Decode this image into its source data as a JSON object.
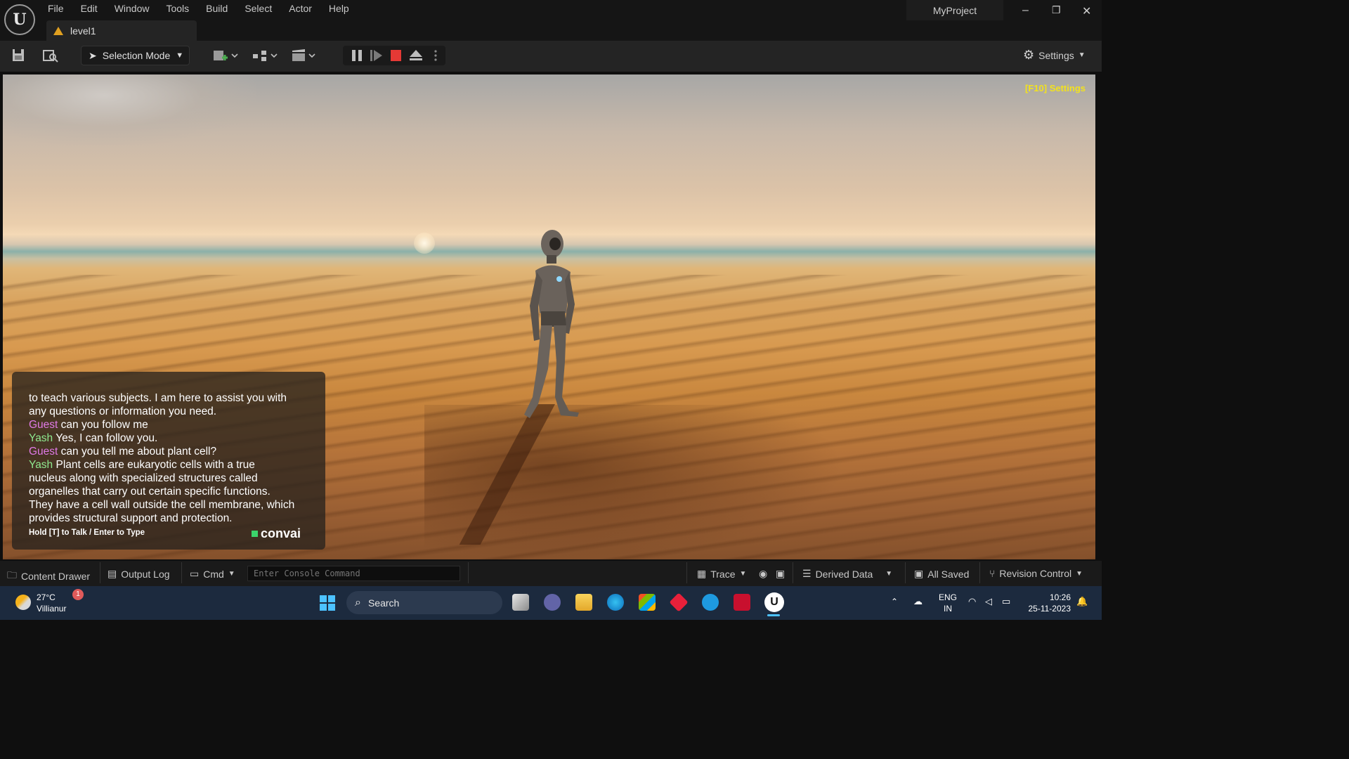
{
  "titlebar": {
    "menu": [
      "File",
      "Edit",
      "Window",
      "Tools",
      "Build",
      "Select",
      "Actor",
      "Help"
    ],
    "tab": "level1",
    "project": "MyProject",
    "window_controls": [
      "–",
      "❐",
      "✕"
    ]
  },
  "toolbar": {
    "selection_mode": "Selection Mode",
    "settings": "Settings"
  },
  "viewport": {
    "f10": "[F10] Settings"
  },
  "chat": {
    "lines": [
      {
        "speaker": "",
        "text": "to teach various subjects.  I am here to assist you with"
      },
      {
        "speaker": "",
        "text": "any questions or information you need."
      },
      {
        "speaker": "Guest",
        "text": " can you follow me"
      },
      {
        "speaker": "Yash",
        "text": "  Yes, I can follow you."
      },
      {
        "speaker": "Guest",
        "text": " can you tell me about plant cell?"
      },
      {
        "speaker": "Yash",
        "text": "  Plant cells are eukaryotic cells with a true"
      },
      {
        "speaker": "",
        "text": "nucleus along with specialized structures called"
      },
      {
        "speaker": "",
        "text": "organelles that carry out certain specific functions."
      },
      {
        "speaker": "",
        "text": "They have a cell wall outside the cell membrane, which"
      },
      {
        "speaker": "",
        "text": "provides structural support and protection."
      }
    ],
    "hint": "Hold [T] to Talk / Enter to Type",
    "brand": "convai"
  },
  "bottombar": {
    "content_drawer": "Content Drawer",
    "output_log": "Output Log",
    "cmd": "Cmd",
    "console_placeholder": "Enter Console Command",
    "trace": "Trace",
    "derived_data": "Derived Data",
    "all_saved": "All Saved",
    "revision_control": "Revision Control"
  },
  "taskbar": {
    "temp": "27°C",
    "location": "Villianur",
    "badge": "1",
    "search": "Search",
    "lang1": "ENG",
    "lang2": "IN",
    "time": "10:26",
    "date": "25-11-2023"
  }
}
